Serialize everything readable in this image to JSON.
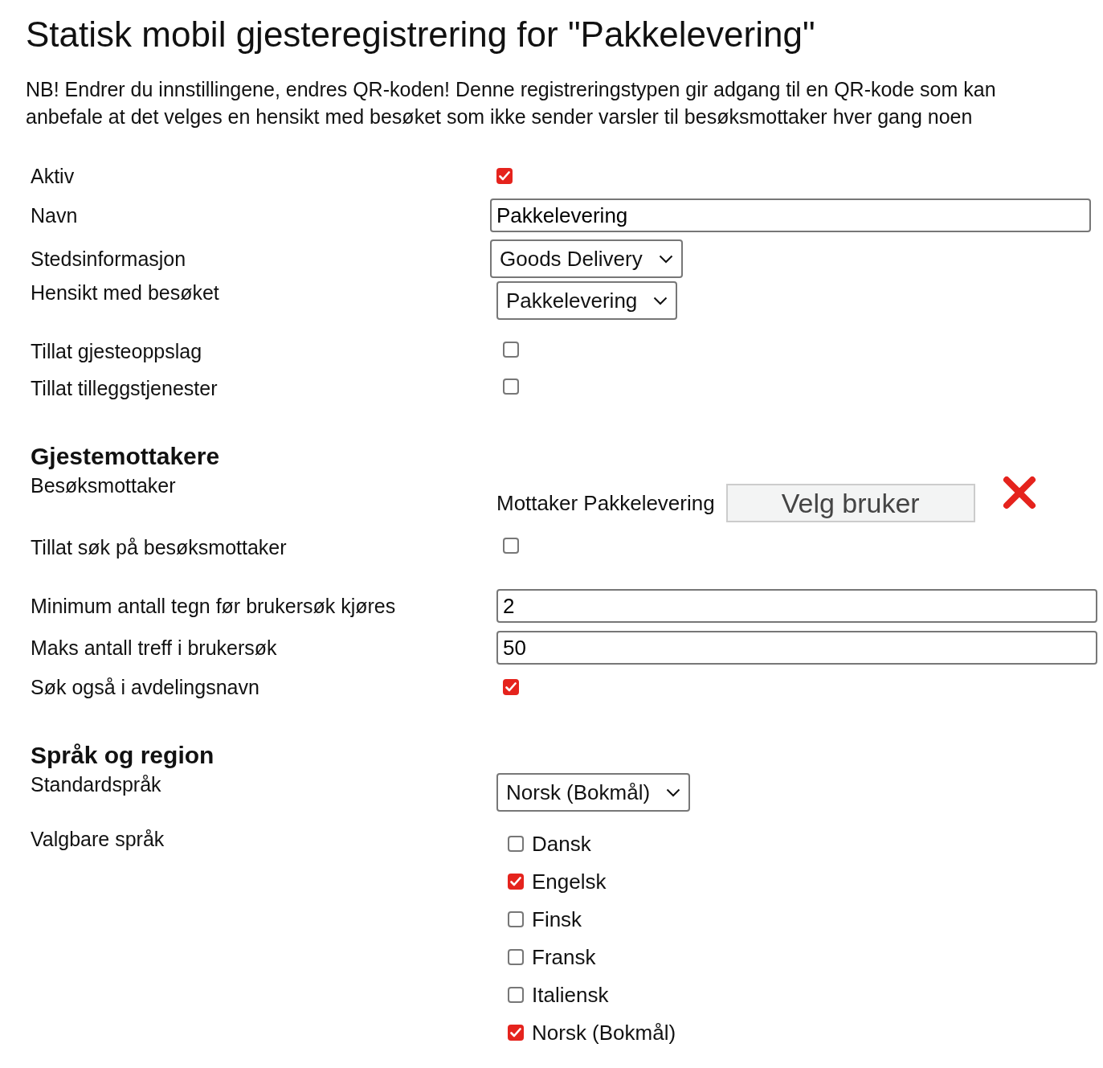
{
  "title": "Statisk mobil gjesteregistrering for \"Pakkelevering\"",
  "notice_lines": [
    "NB! Endrer du innstillingene, endres QR-koden! Denne registreringstypen gir adgang til en QR-kode som kan",
    "anbefale at det velges en hensikt med besøket som ikke sender varsler til besøksmottaker hver gang noen"
  ],
  "fields": [
    {
      "kind": "checkbox",
      "label": "Aktiv",
      "checked": true
    },
    {
      "kind": "text",
      "label": "Navn",
      "value": "Pakkelevering"
    },
    {
      "kind": "select",
      "label": "Stedsinformasjon",
      "value": "Goods Delivery"
    },
    {
      "kind": "select",
      "label": "Hensikt med besøket",
      "value": "Pakkelevering"
    },
    {
      "kind": "checkbox",
      "label": "Tillat gjesteoppslag",
      "checked": false
    },
    {
      "kind": "checkbox",
      "label": "Tillat tilleggstjenester",
      "checked": false
    },
    {
      "kind": "heading",
      "label": "Gjestemottakere"
    },
    {
      "kind": "recipient",
      "label": "Besøksmottaker",
      "recipient": "Mottaker Pakkelevering",
      "button": "Velg bruker"
    },
    {
      "kind": "checkbox",
      "label": "Tillat søk på besøksmottaker",
      "checked": false
    },
    {
      "kind": "text",
      "label": "Minimum antall tegn før brukersøk kjøres",
      "value": "2"
    },
    {
      "kind": "text",
      "label": "Maks antall treff i brukersøk",
      "value": "50"
    },
    {
      "kind": "checkbox",
      "label": "Søk også i avdelingsnavn",
      "checked": true
    },
    {
      "kind": "heading",
      "label": "Språk og region"
    },
    {
      "kind": "select",
      "label": "Standardspråk",
      "value": "Norsk (Bokmål)"
    },
    {
      "kind": "checklist",
      "label": "Valgbare språk",
      "options": [
        {
          "label": "Dansk",
          "checked": false
        },
        {
          "label": "Engelsk",
          "checked": true
        },
        {
          "label": "Finsk",
          "checked": false
        },
        {
          "label": "Fransk",
          "checked": false
        },
        {
          "label": "Italiensk",
          "checked": false
        },
        {
          "label": "Norsk (Bokmål)",
          "checked": true
        }
      ]
    }
  ]
}
